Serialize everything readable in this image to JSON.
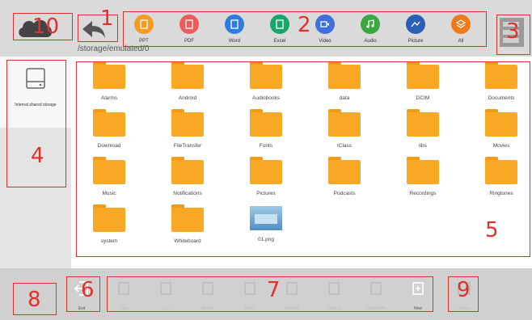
{
  "top_bar": {
    "file_types": [
      {
        "label": "PPT",
        "icon": "ppt-icon",
        "color": "#f59a23"
      },
      {
        "label": "PDF",
        "icon": "pdf-icon",
        "color": "#ef5a5a"
      },
      {
        "label": "Word",
        "icon": "word-icon",
        "color": "#2d7de0"
      },
      {
        "label": "Excel",
        "icon": "excel-icon",
        "color": "#1aa56a"
      },
      {
        "label": "Video",
        "icon": "video-icon",
        "color": "#3f6fd8"
      },
      {
        "label": "Audio",
        "icon": "audio-icon",
        "color": "#3aa83d"
      },
      {
        "label": "Picture",
        "icon": "picture-icon",
        "color": "#2a5fb5"
      },
      {
        "label": "All",
        "icon": "all-icon",
        "color": "#f07a1a"
      }
    ]
  },
  "path": "/storage/emulated/0",
  "sidebar": {
    "storage_label": "Internal shared storage"
  },
  "files": [
    {
      "name": "Alarms",
      "kind": "folder"
    },
    {
      "name": "Android",
      "kind": "folder"
    },
    {
      "name": "Audiobooks",
      "kind": "folder"
    },
    {
      "name": "data",
      "kind": "folder"
    },
    {
      "name": "DCIM",
      "kind": "folder"
    },
    {
      "name": "Documents",
      "kind": "folder"
    },
    {
      "name": "Download",
      "kind": "folder"
    },
    {
      "name": "FileTransfer",
      "kind": "folder"
    },
    {
      "name": "Fonts",
      "kind": "folder"
    },
    {
      "name": "IClass",
      "kind": "folder"
    },
    {
      "name": "libs",
      "kind": "folder"
    },
    {
      "name": "Movies",
      "kind": "folder"
    },
    {
      "name": "Music",
      "kind": "folder"
    },
    {
      "name": "Notifications",
      "kind": "folder"
    },
    {
      "name": "Pictures",
      "kind": "folder"
    },
    {
      "name": "Podcasts",
      "kind": "folder"
    },
    {
      "name": "Recordings",
      "kind": "folder"
    },
    {
      "name": "Ringtones",
      "kind": "folder"
    },
    {
      "name": "system",
      "kind": "folder"
    },
    {
      "name": "Whiteboard",
      "kind": "folder"
    },
    {
      "name": "01.png",
      "kind": "image"
    }
  ],
  "bottom_bar": {
    "exit_label": "Exit",
    "actions": [
      {
        "label": "Copy",
        "enabled": false,
        "icon": "copy-icon"
      },
      {
        "label": "Cut",
        "enabled": false,
        "icon": "cut-icon"
      },
      {
        "label": "Delete",
        "enabled": false,
        "icon": "delete-icon"
      },
      {
        "label": "Paste",
        "enabled": false,
        "icon": "paste-icon"
      },
      {
        "label": "Rename",
        "enabled": false,
        "icon": "rename-icon"
      },
      {
        "label": "Open In",
        "enabled": false,
        "icon": "open-in-icon"
      },
      {
        "label": "Open With",
        "enabled": false,
        "icon": "open-with-icon"
      },
      {
        "label": "New",
        "enabled": true,
        "icon": "new-folder-icon"
      }
    ],
    "select_label": "Select"
  },
  "annotations": [
    "1",
    "2",
    "3",
    "4",
    "5",
    "6",
    "7",
    "8",
    "9",
    "10"
  ],
  "colors": {
    "annotation": "#e0302c",
    "folder": "#f9a825",
    "top_bar": "#dadada",
    "bottom_bar": "#d0d0d0"
  }
}
